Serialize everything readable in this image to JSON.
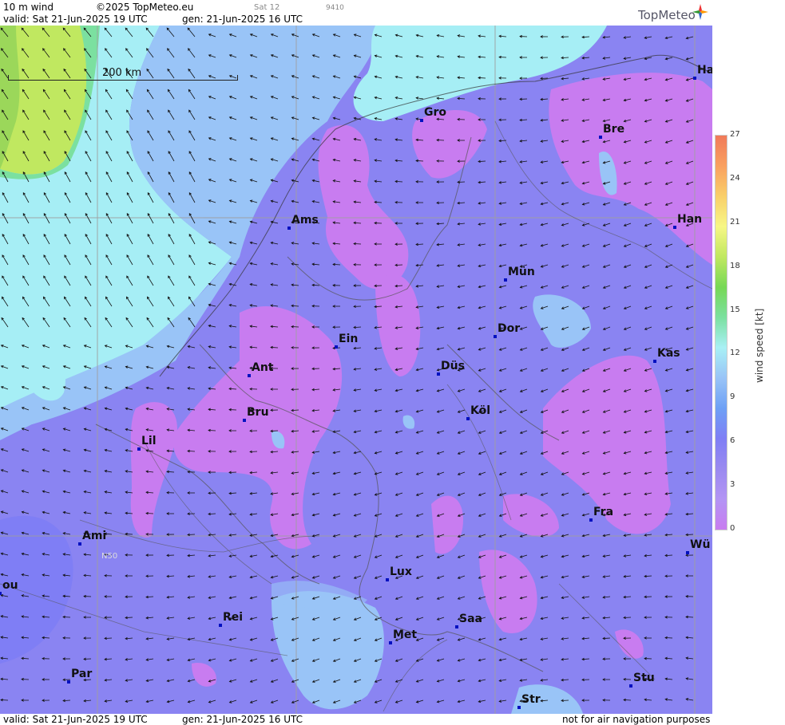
{
  "header": {
    "product": "10 m wind",
    "copyright": "©2025 TopMeteo.eu",
    "sat": "Sat 12",
    "code": "9410",
    "valid": "valid:  Sat  21-Jun-2025  19 UTC",
    "gen": "gen:  21-Jun-2025 16 UTC",
    "logo": "TopMeteo"
  },
  "footer": {
    "valid": "valid:  Sat  21-Jun-2025  19 UTC",
    "gen": "gen:  21-Jun-2025 16 UTC",
    "disclaimer": "not for air navigation purposes"
  },
  "scale": {
    "label": "200 km"
  },
  "grid_label": "N50",
  "legend": {
    "title": "wind  speed  [kt]",
    "ticks": [
      "27",
      "24",
      "21",
      "18",
      "15",
      "12",
      "9",
      "6",
      "3",
      "0"
    ],
    "colors": [
      "#c87cf0",
      "#b394f4",
      "#9a8af0",
      "#7f7ef5",
      "#6ea0f5",
      "#99c4f7",
      "#a8f0f5",
      "#7be0a0",
      "#76d856",
      "#c0e860",
      "#f7f785",
      "#f9cf6a",
      "#f9a060",
      "#f07a5a"
    ]
  },
  "cities": [
    {
      "name": "Ha"
    },
    {
      "name": "Gro"
    },
    {
      "name": "Bre"
    },
    {
      "name": "Ams"
    },
    {
      "name": "Han"
    },
    {
      "name": "Mün"
    },
    {
      "name": "Dor"
    },
    {
      "name": "Ein"
    },
    {
      "name": "Ant"
    },
    {
      "name": "Düs"
    },
    {
      "name": "Kas"
    },
    {
      "name": "Bru"
    },
    {
      "name": "Köl"
    },
    {
      "name": "Lil"
    },
    {
      "name": "Fra"
    },
    {
      "name": "Ami"
    },
    {
      "name": "Wü"
    },
    {
      "name": "Lux"
    },
    {
      "name": "ou"
    },
    {
      "name": "Rei"
    },
    {
      "name": "Saa"
    },
    {
      "name": "Met"
    },
    {
      "name": "Par"
    },
    {
      "name": "Stu"
    },
    {
      "name": "Str"
    }
  ]
}
